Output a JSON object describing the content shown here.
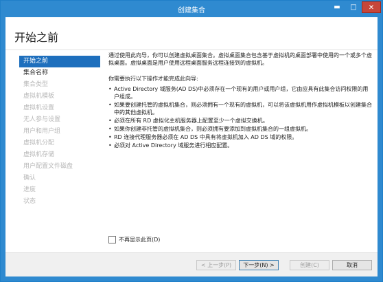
{
  "window": {
    "title": "创建集合",
    "minimize_glyph": "▬",
    "maximize_glyph": "□",
    "close_glyph": "✕"
  },
  "page": {
    "title": "开始之前"
  },
  "sidebar": {
    "items": [
      {
        "label": "开始之前",
        "state": "active"
      },
      {
        "label": "集合名称",
        "state": "enabled"
      },
      {
        "label": "集合类型",
        "state": "disabled"
      },
      {
        "label": "虚拟机模板",
        "state": "disabled"
      },
      {
        "label": "虚拟机设置",
        "state": "disabled"
      },
      {
        "label": "无人参与设置",
        "state": "disabled"
      },
      {
        "label": "用户和用户组",
        "state": "disabled"
      },
      {
        "label": "虚拟机分配",
        "state": "disabled"
      },
      {
        "label": "虚拟机存储",
        "state": "disabled"
      },
      {
        "label": "用户配置文件磁盘",
        "state": "disabled"
      },
      {
        "label": "确认",
        "state": "disabled"
      },
      {
        "label": "进度",
        "state": "disabled"
      },
      {
        "label": "状态",
        "state": "disabled"
      }
    ]
  },
  "content": {
    "intro": "通过使用此向导，你可以创建虚拟桌面集合。虚拟桌面集合包含基于虚拟机的桌面部署中使用的一个或多个虚拟桌面。虚拟桌面是用户使用远程桌面服务远程连接到的虚拟机。",
    "requirements_heading": "你需要执行以下操作才能完成此向导:",
    "requirements": [
      "Active Directory 域服务(AD DS)中必须存在一个现有的用户或用户组，它由应具有此集合访问权限的用户组成。",
      "如果要创建托管的虚拟机集合，则必须拥有一个现有的虚拟机，可以将该虚拟机用作虚拟机模板以创建集合中的其他虚拟机。",
      "必须在所有 RD 虚拟化主机服务器上配置至少一个虚拟交换机。",
      "如果你创建非托管的虚拟机集合，则必须拥有要添加到虚拟机集合的一组虚拟机。",
      "RD 连接代理服务器必须在 AD DS 中具有将虚拟机加入 AD DS 域的权限。",
      "必须对 Active Directory 域服务进行相应配置。"
    ]
  },
  "options": {
    "dont_show_label": "不再显示此页(D)",
    "dont_show_checked": false
  },
  "footer": {
    "prev_label": "< 上一步(P)",
    "next_label": "下一步(N) >",
    "create_label": "创建(C)",
    "cancel_label": "取消"
  },
  "colors": {
    "titlebar": "#2f8ad0",
    "active_nav": "#1e6fbd",
    "close_button": "#c7463a"
  }
}
